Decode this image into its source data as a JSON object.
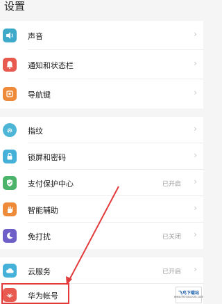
{
  "header": {
    "title": "设置"
  },
  "colors": {
    "arrow": "#e33b3b",
    "highlight": "#e33b3b"
  },
  "groups": [
    {
      "items": [
        {
          "label": "声音",
          "icon": "speaker-icon",
          "icon_color": "#3fa9c9",
          "value": ""
        },
        {
          "label": "通知和状态栏",
          "icon": "bell-icon",
          "icon_color": "#e85a4f",
          "value": ""
        },
        {
          "label": "导航键",
          "icon": "navigation-key-icon",
          "icon_color": "#ee8b3a",
          "value": ""
        }
      ]
    },
    {
      "items": [
        {
          "label": "指纹",
          "icon": "fingerprint-icon",
          "icon_color": "#4db6d6",
          "value": ""
        },
        {
          "label": "锁屏和密码",
          "icon": "lock-icon",
          "icon_color": "#45b1d8",
          "value": ""
        },
        {
          "label": "支付保护中心",
          "icon": "shield-icon",
          "icon_color": "#4cb46a",
          "value": "已开启"
        },
        {
          "label": "智能辅助",
          "icon": "hand-icon",
          "icon_color": "#ee8b3a",
          "value": ""
        },
        {
          "label": "免打扰",
          "icon": "moon-icon",
          "icon_color": "#6d5fc7",
          "value": "已关闭"
        }
      ]
    },
    {
      "items": [
        {
          "label": "云服务",
          "icon": "cloud-icon",
          "icon_color": "#45b1d8",
          "value": "已开启"
        },
        {
          "label": "华为帐号",
          "icon": "huawei-account-icon",
          "icon_color": "#e85a4f",
          "value": ""
        }
      ]
    }
  ],
  "watermark": {
    "line1": "飞鸟下载站",
    "line2": "www.feiniaocom.com"
  }
}
